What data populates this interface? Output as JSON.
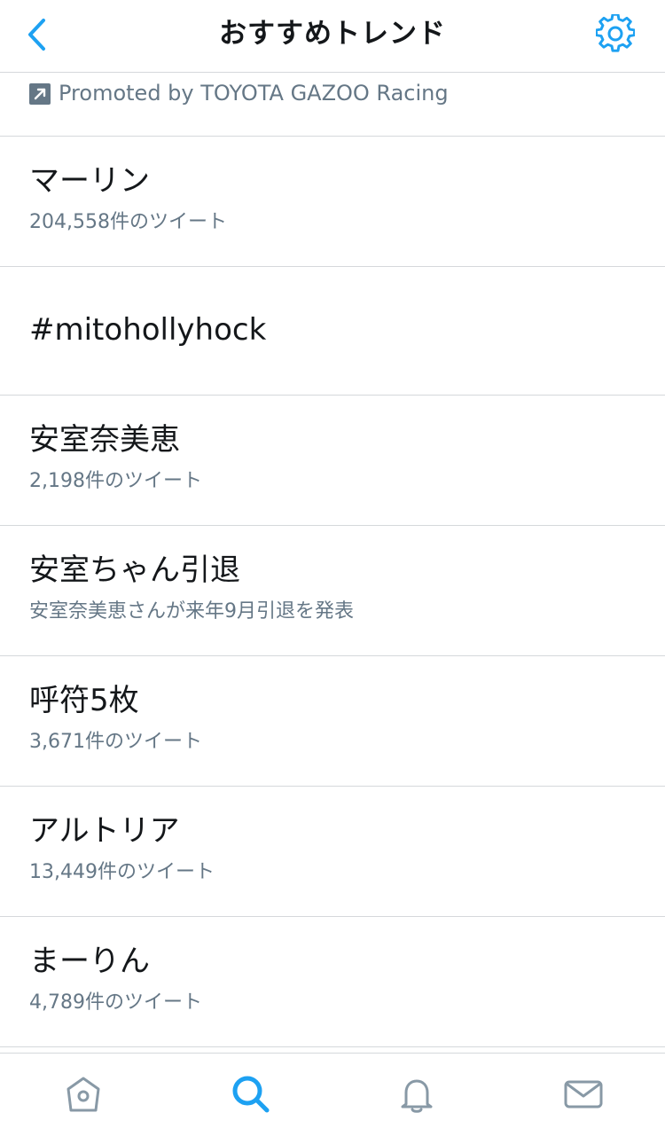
{
  "header": {
    "title": "おすすめトレンド",
    "back_icon": "chevron-left-icon",
    "settings_icon": "gear-icon"
  },
  "promoted": {
    "text": "Promoted by TOYOTA GAZOO Racing",
    "icon": "promoted-arrow-icon"
  },
  "trends": [
    {
      "name": "マーリン",
      "meta": "204,558件のツイート"
    },
    {
      "name": "#mitohollyhock",
      "meta": ""
    },
    {
      "name": "安室奈美恵",
      "meta": "2,198件のツイート"
    },
    {
      "name": "安室ちゃん引退",
      "meta": "安室奈美恵さんが来年9月引退を発表"
    },
    {
      "name": "呼符5枚",
      "meta": "3,671件のツイート"
    },
    {
      "name": "アルトリア",
      "meta": "13,449件のツイート"
    },
    {
      "name": "まーりん",
      "meta": "4,789件のツイート"
    }
  ],
  "tabbar": {
    "items": [
      {
        "icon": "home-icon",
        "active": false
      },
      {
        "icon": "search-icon",
        "active": true
      },
      {
        "icon": "notifications-bell-icon",
        "active": false
      },
      {
        "icon": "messages-envelope-icon",
        "active": false
      }
    ]
  },
  "colors": {
    "accent": "#1da1f2",
    "secondary_text": "#657786",
    "divider": "#d5d8db",
    "inactive_icon": "#8899a6"
  }
}
